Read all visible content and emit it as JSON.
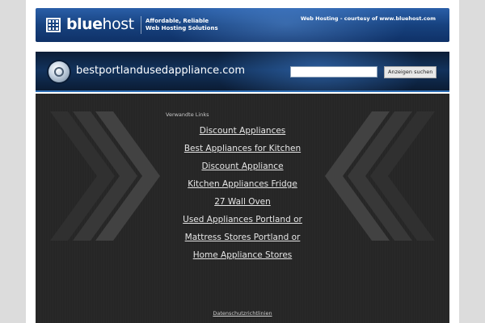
{
  "banner": {
    "logo_bold": "blue",
    "logo_light": "host",
    "tagline_line1": "Affordable, Reliable",
    "tagline_line2": "Web Hosting Solutions",
    "courtesy": "Web Hosting - courtesy of www.bluehost.com",
    "brand_color": "#17427f"
  },
  "header": {
    "domain": "bestportlandusedappliance.com",
    "search_value": "",
    "search_button": "Anzeigen suchen",
    "accent_color": "#2f6fb6"
  },
  "main": {
    "related_label": "Verwandte Links",
    "links": [
      "Discount Appliances",
      "Best Appliances for Kitchen",
      "Discount Appliance",
      "Kitchen Appliances Fridge",
      "27 Wall Oven",
      "Used Appliances Portland or",
      "Mattress Stores Portland or",
      "Home Appliance Stores"
    ],
    "privacy_link": "Datenschutzrichtlinien",
    "background_color": "#262626"
  },
  "icons": [
    "bluehost-logo-icon",
    "site-globe-icon",
    "chevron-left-decor-icon",
    "chevron-right-decor-icon"
  ]
}
